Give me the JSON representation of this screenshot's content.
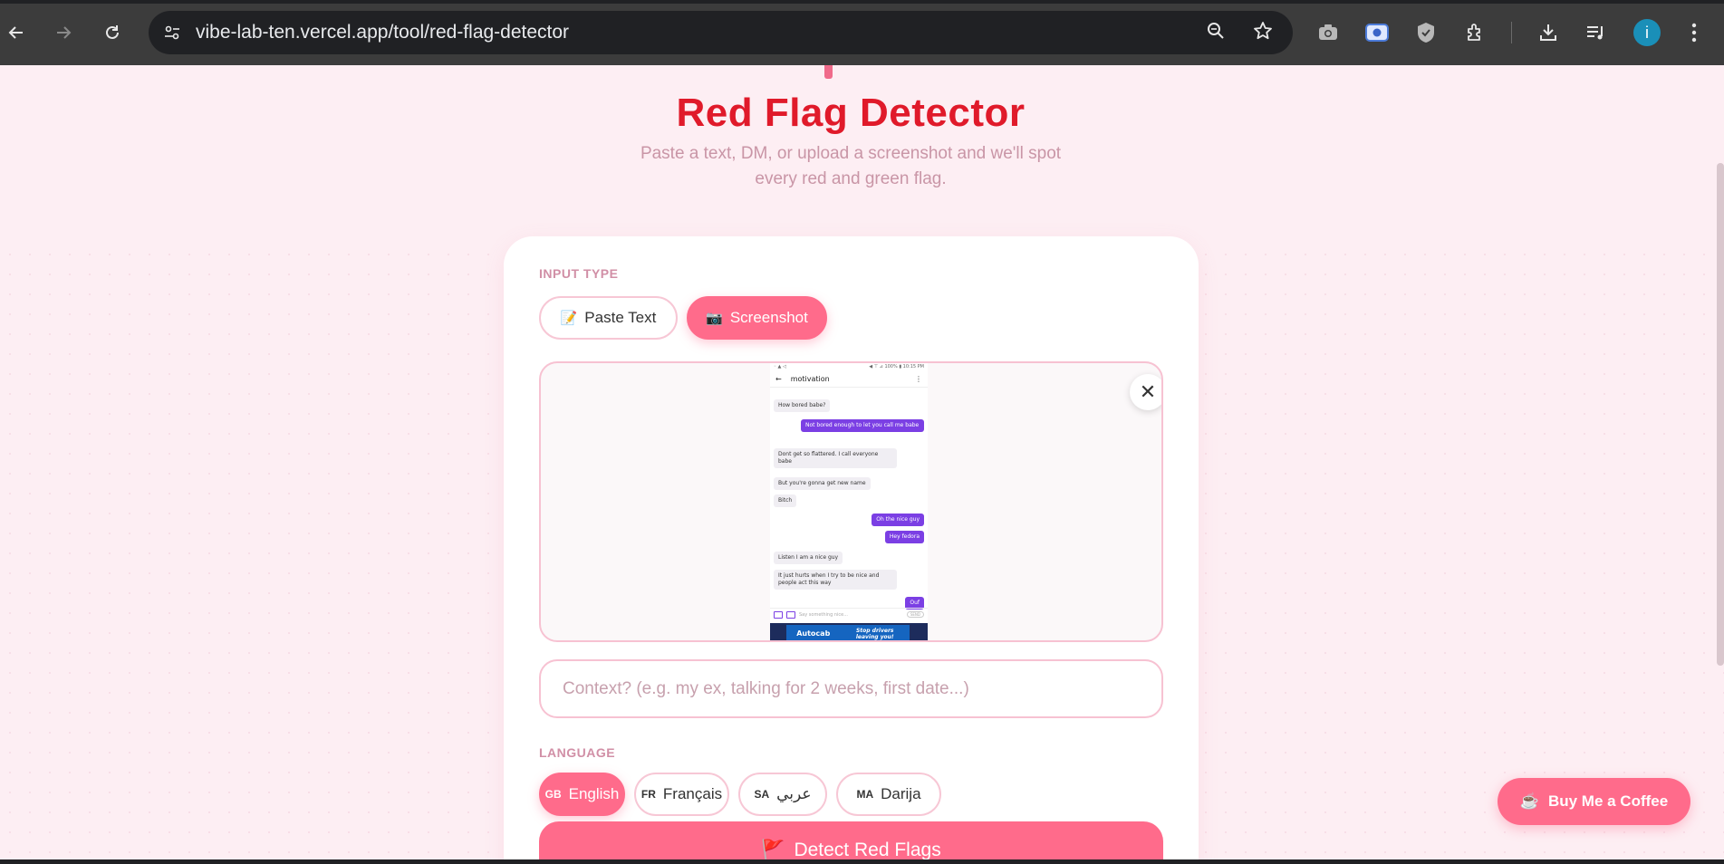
{
  "browser": {
    "url": "vibe-lab-ten.vercel.app/tool/red-flag-detector",
    "profile_initial": "i"
  },
  "hero": {
    "title": "Red Flag Detector",
    "subtitle": "Paste a text, DM, or upload a screenshot and we'll spot every red and green flag."
  },
  "input_type": {
    "label": "INPUT TYPE",
    "options": [
      {
        "emoji": "📝",
        "label": "Paste Text",
        "active": false
      },
      {
        "emoji": "📷",
        "label": "Screenshot",
        "active": true
      }
    ]
  },
  "screenshot_preview": {
    "close_label": "✕",
    "chat": {
      "status_left": "◦ ▲ ◁",
      "status_right": "◀ ⊤ ⊿ 100% ▮ 10:15 PM",
      "contact": "motivation",
      "messages": [
        {
          "dir": "in",
          "text": "How bored babe?"
        },
        {
          "dir": "out",
          "text": "Not bored enough to let you call me babe"
        },
        {
          "dir": "in",
          "text": "Dont get so flattered. I call everyone babe"
        },
        {
          "dir": "in",
          "text": "But you're gonna get new name"
        },
        {
          "dir": "in",
          "text": "Bitch"
        },
        {
          "dir": "out",
          "text": "Oh the nice guy"
        },
        {
          "dir": "out",
          "text": "Hey fedora"
        },
        {
          "dir": "in",
          "text": "Listen I am a nice guy"
        },
        {
          "dir": "in",
          "text": "It just hurts when I try to be nice and people act this way"
        },
        {
          "dir": "out",
          "text": "Ouf"
        }
      ],
      "input_placeholder": "Say something nice...",
      "send_label": "SEND",
      "ad_brand": "Autocab",
      "ad_tagline": "Stop drivers leaving you!"
    }
  },
  "context": {
    "placeholder": "Context? (e.g. my ex, talking for 2 weeks, first date...)"
  },
  "language": {
    "label": "LANGUAGE",
    "options": [
      {
        "flag": "GB",
        "label": "English",
        "active": true
      },
      {
        "flag": "FR",
        "label": "Français",
        "active": false
      },
      {
        "flag": "SA",
        "label": "عربي",
        "active": false
      },
      {
        "flag": "MA",
        "label": "Darija",
        "active": false
      }
    ]
  },
  "detect_button": {
    "emoji": "🚩",
    "label": "Detect Red Flags"
  },
  "coffee_button": {
    "emoji": "☕",
    "label": "Buy Me a Coffee"
  },
  "colors": {
    "accent": "#ff6b8b",
    "title_red": "#e01a2a",
    "chat_purple": "#7b3fe4",
    "page_bg": "#fdeef3"
  }
}
